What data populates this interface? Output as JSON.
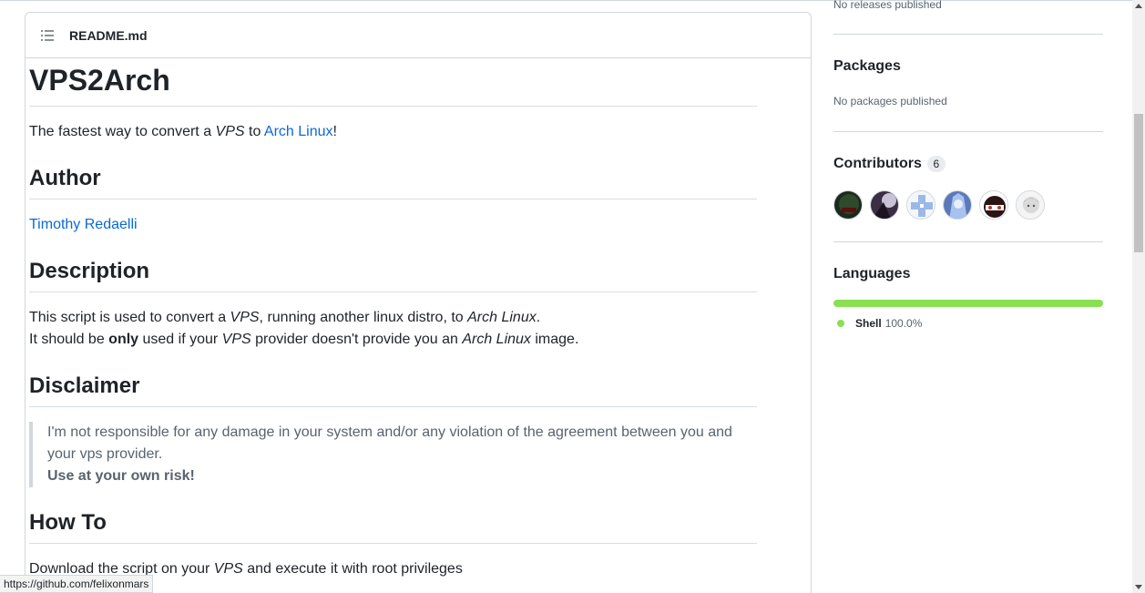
{
  "readme": {
    "filename": "README.md",
    "title": "VPS2Arch",
    "intro": {
      "prefix": "The fastest way to convert a ",
      "vps": "VPS",
      "to": " to ",
      "link": "Arch Linux",
      "suffix": "!"
    },
    "author_heading": "Author",
    "author_link": "Timothy Redaelli",
    "description_heading": "Description",
    "desc_line1": {
      "a": "This script is used to convert a ",
      "vps": "VPS",
      "b": ", running another linux distro, to ",
      "arch": "Arch Linux",
      "c": "."
    },
    "desc_line2": {
      "a": "It should be ",
      "only": "only",
      "b": " used if your ",
      "vps": "VPS",
      "c": " provider doesn't provide you an ",
      "arch": "Arch Linux",
      "d": " image."
    },
    "disclaimer_heading": "Disclaimer",
    "disclaimer_text": "I'm not responsible for any damage in your system and/or any violation of the agreement between you and your vps provider.",
    "disclaimer_strong": "Use at your own risk!",
    "howto_heading": "How To",
    "howto_line": {
      "a": "Download the script on your ",
      "vps": "VPS",
      "b": " and execute it with root privileges"
    }
  },
  "sidebar": {
    "releases_text": "No releases published",
    "packages_title": "Packages",
    "packages_text": "No packages published",
    "contributors_title": "Contributors",
    "contributors_count": "6",
    "languages_title": "Languages",
    "language": {
      "name": "Shell",
      "percent": "100.0%",
      "color": "#89e051"
    }
  },
  "statusbar_url": "https://github.com/felixonmars"
}
